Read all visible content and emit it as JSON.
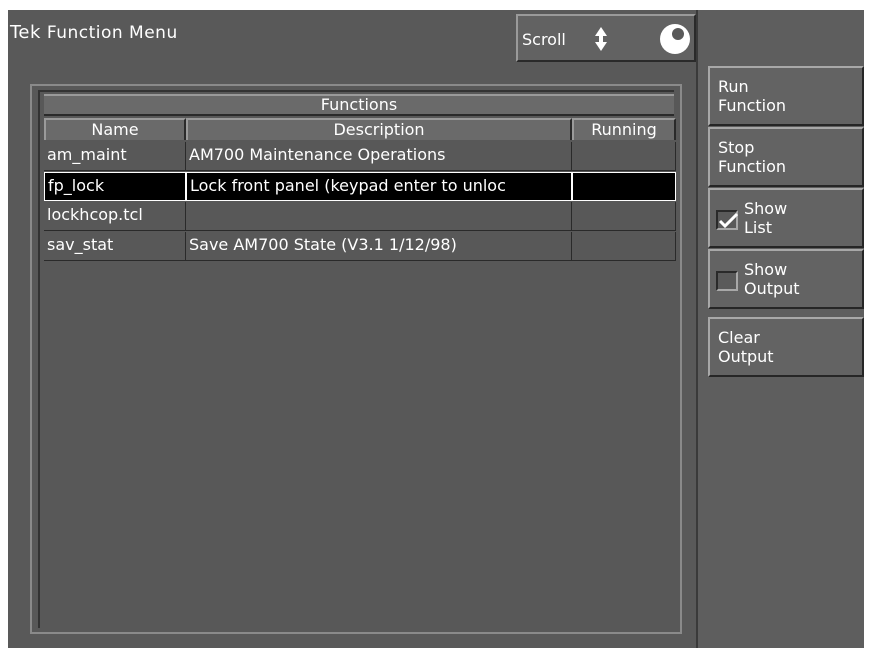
{
  "app": {
    "brand": "Tek",
    "title": "Function Menu"
  },
  "scroll": {
    "label": "Scroll"
  },
  "table": {
    "caption": "Functions",
    "columns": [
      "Name",
      "Description",
      "Running"
    ],
    "rows": [
      {
        "name": "am_maint",
        "description": "AM700 Maintenance Operations",
        "running": ""
      },
      {
        "name": "fp_lock",
        "description": "Lock front panel (keypad enter to unloc",
        "running": "",
        "selected": true
      },
      {
        "name": "lockhcop.tcl",
        "description": "",
        "running": ""
      },
      {
        "name": "sav_stat",
        "description": "Save AM700 State   (V3.1   1/12/98)",
        "running": ""
      }
    ]
  },
  "side": {
    "run": "Run\nFunction",
    "stop": "Stop\nFunction",
    "show_list": "Show\nList",
    "show_list_checked": true,
    "show_output": "Show\nOutput",
    "show_output_checked": false,
    "clear": "Clear\nOutput"
  }
}
